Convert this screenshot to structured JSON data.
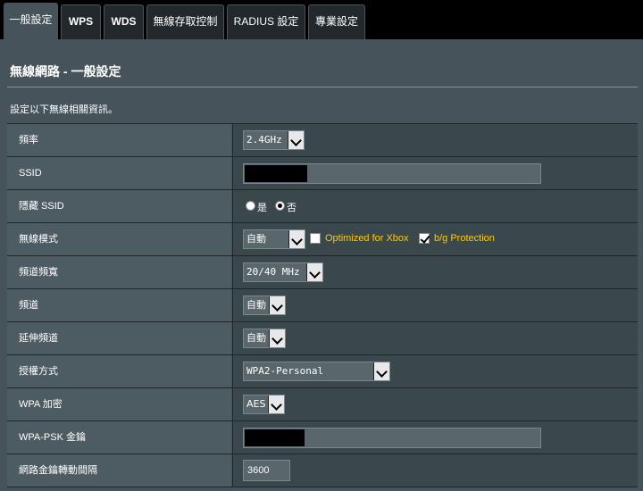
{
  "tabs": [
    "一般設定",
    "WPS",
    "WDS",
    "無線存取控制",
    "RADIUS 設定",
    "專業設定"
  ],
  "page": {
    "title": "無線網路 - 一般設定",
    "description": "設定以下無線相關資訊。"
  },
  "fields": {
    "band": {
      "label": "頻率",
      "value": "2.4GHz"
    },
    "ssid": {
      "label": "SSID"
    },
    "hide_ssid": {
      "label": "隱藏 SSID",
      "yes": "是",
      "no": "否",
      "selected": "否"
    },
    "wireless_mode": {
      "label": "無線模式",
      "value": "自動",
      "xbox_label": "Optimized for Xbox",
      "xbox_checked": false,
      "bg_label": "b/g Protection",
      "bg_checked": true
    },
    "bandwidth": {
      "label": "頻道頻寬",
      "value": "20/40 MHz"
    },
    "channel": {
      "label": "頻道",
      "value": "自動"
    },
    "ext_channel": {
      "label": "延伸頻道",
      "value": "自動"
    },
    "auth_method": {
      "label": "授權方式",
      "value": "WPA2-Personal"
    },
    "wpa_encryption": {
      "label": "WPA 加密",
      "value": "AES"
    },
    "wpa_psk_key": {
      "label": "WPA-PSK 金鑰"
    },
    "key_rotation": {
      "label": "網路金鑰轉動間隔",
      "value": "3600"
    }
  },
  "colors": {
    "accent_label": "#ffcc00",
    "content_bg": "#46535a",
    "tab_bg": "#21292c"
  }
}
